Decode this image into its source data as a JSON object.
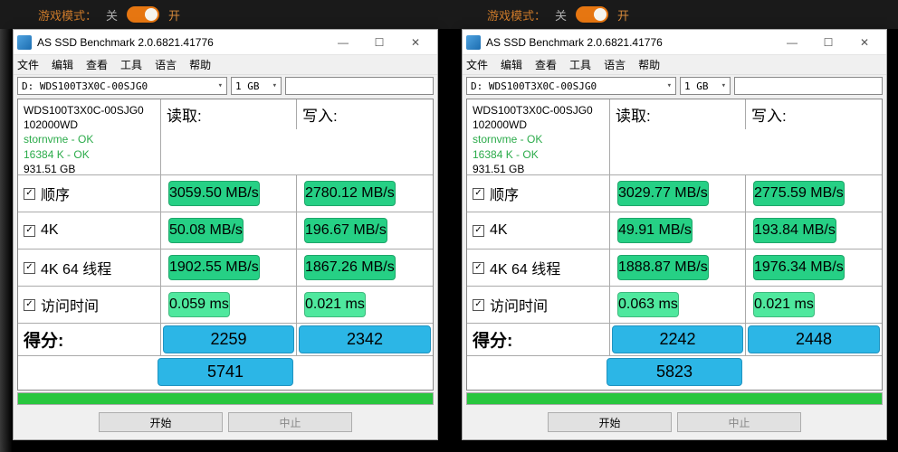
{
  "top": {
    "mode_label": "游戏模式：",
    "off": "关",
    "on": "开"
  },
  "title": "AS SSD Benchmark 2.0.6821.41776",
  "menu": [
    "文件",
    "编辑",
    "查看",
    "工具",
    "语言",
    "帮助"
  ],
  "drive": "D: WDS100T3X0C-00SJG0",
  "size": "1 GB",
  "drive_name": "WDS100T3X0C-00SJG0",
  "serial": "102000WD",
  "status1": "stornvme - OK",
  "status2": "16384 K - OK",
  "capacity": "931.51 GB",
  "hdr_read": "读取:",
  "hdr_write": "写入:",
  "rows": {
    "seq": "顺序",
    "r4k": "4K",
    "r4k64": "4K 64 线程",
    "acc": "访问时间",
    "score": "得分:"
  },
  "left": {
    "seq_r": "3059.50 MB/s",
    "seq_w": "2780.12 MB/s",
    "r4k_r": "50.08 MB/s",
    "r4k_w": "196.67 MB/s",
    "r64_r": "1902.55 MB/s",
    "r64_w": "1867.26 MB/s",
    "acc_r": "0.059 ms",
    "acc_w": "0.021 ms",
    "sc_r": "2259",
    "sc_w": "2342",
    "total": "5741"
  },
  "right": {
    "seq_r": "3029.77 MB/s",
    "seq_w": "2775.59 MB/s",
    "r4k_r": "49.91 MB/s",
    "r4k_w": "193.84 MB/s",
    "r64_r": "1888.87 MB/s",
    "r64_w": "1976.34 MB/s",
    "acc_r": "0.063 ms",
    "acc_w": "0.021 ms",
    "sc_r": "2242",
    "sc_w": "2448",
    "total": "5823"
  },
  "btn_start": "开始",
  "btn_stop": "中止"
}
